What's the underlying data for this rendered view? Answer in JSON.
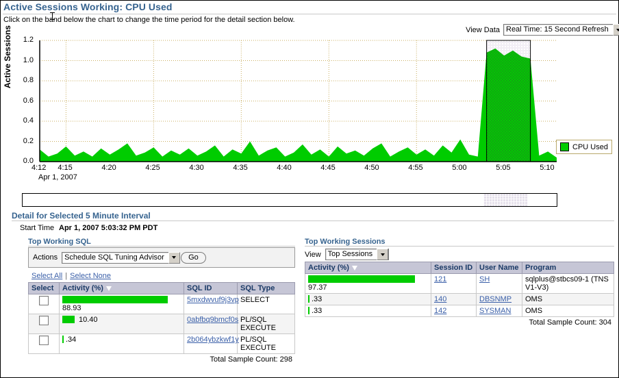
{
  "header": {
    "title": "Active Sessions Working: CPU Used",
    "instruction": "Click on the band below the chart to change the time period for the detail section below."
  },
  "view_data": {
    "label": "View Data",
    "value": "Real Time: 15 Second Refresh"
  },
  "chart_data": {
    "type": "area",
    "title": "Active Sessions Working: CPU Used",
    "xlabel": "",
    "ylabel": "Active Sessions",
    "date_label": "Apr 1, 2007",
    "ylim": [
      0.0,
      1.2
    ],
    "yticks": [
      "0.0",
      "0.2",
      "0.4",
      "0.6",
      "0.8",
      "1.0",
      "1.2"
    ],
    "xticks": [
      "4:12",
      "4:15",
      "4:20",
      "4:25",
      "4:30",
      "4:35",
      "4:40",
      "4:45",
      "4:50",
      "4:55",
      "5:00",
      "5:05",
      "5:10"
    ],
    "grid": true,
    "legend": [
      {
        "name": "CPU Used",
        "color": "#00cc00"
      }
    ],
    "legend_position": "right",
    "selection": {
      "from": "5:03:32",
      "to": "5:08:32",
      "highlight": true
    },
    "series": [
      {
        "name": "CPU Used",
        "color": "#00cc00",
        "x": [
          "4:12",
          "4:13",
          "4:14",
          "4:15",
          "4:16",
          "4:17",
          "4:18",
          "4:19",
          "4:20",
          "4:21",
          "4:22",
          "4:23",
          "4:24",
          "4:25",
          "4:26",
          "4:27",
          "4:28",
          "4:29",
          "4:30",
          "4:31",
          "4:32",
          "4:33",
          "4:34",
          "4:35",
          "4:36",
          "4:37",
          "4:38",
          "4:39",
          "4:40",
          "4:41",
          "4:42",
          "4:43",
          "4:44",
          "4:45",
          "4:46",
          "4:47",
          "4:48",
          "4:49",
          "4:50",
          "4:51",
          "4:52",
          "4:53",
          "4:54",
          "4:55",
          "4:56",
          "4:57",
          "4:58",
          "4:59",
          "5:00",
          "5:01",
          "5:02",
          "5:03",
          "5:04",
          "5:05",
          "5:06",
          "5:07",
          "5:08",
          "5:09",
          "5:10",
          "5:11"
        ],
        "values": [
          0.12,
          0.05,
          0.08,
          0.15,
          0.06,
          0.1,
          0.05,
          0.13,
          0.07,
          0.12,
          0.18,
          0.06,
          0.09,
          0.14,
          0.05,
          0.11,
          0.07,
          0.13,
          0.06,
          0.1,
          0.16,
          0.05,
          0.12,
          0.08,
          0.2,
          0.06,
          0.11,
          0.14,
          0.05,
          0.09,
          0.17,
          0.07,
          0.12,
          0.05,
          0.15,
          0.08,
          0.11,
          0.06,
          0.13,
          0.18,
          0.05,
          0.1,
          0.14,
          0.07,
          0.12,
          0.06,
          0.16,
          0.09,
          0.22,
          0.07,
          0.05,
          1.08,
          1.12,
          1.05,
          1.1,
          1.04,
          1.02,
          0.06,
          0.1,
          0.04
        ]
      }
    ]
  },
  "detail": {
    "title": "Detail for Selected 5 Minute Interval",
    "start_time_label": "Start Time",
    "start_time_value": "Apr 1, 2007 5:03:32 PM PDT"
  },
  "top_sql": {
    "title": "Top Working SQL",
    "actions_label": "Actions",
    "actions_value": "Schedule SQL Tuning Advisor",
    "go_label": "Go",
    "select_all": "Select All",
    "select_none": "Select None",
    "columns": [
      "Select",
      "Activity (%)",
      "SQL ID",
      "SQL Type"
    ],
    "rows": [
      {
        "activity": "88.93",
        "pct": 88.93,
        "sql_id": "5mxdwvuf9j3vp",
        "sql_type": "SELECT"
      },
      {
        "activity": "10.40",
        "pct": 10.4,
        "sql_id": "0abfbq9bmcf0s",
        "sql_type": "PL/SQL EXECUTE"
      },
      {
        "activity": ".34",
        "pct": 0.34,
        "sql_id": "2b064ybzkwf1y",
        "sql_type": "PL/SQL EXECUTE"
      }
    ],
    "total": "Total Sample Count: 298"
  },
  "top_sessions": {
    "title": "Top Working Sessions",
    "view_label": "View",
    "view_value": "Top Sessions",
    "columns": [
      "Activity (%)",
      "Session ID",
      "User Name",
      "Program"
    ],
    "rows": [
      {
        "activity": "97.37",
        "pct": 97.37,
        "session_id": "121",
        "user_name": "SH",
        "program": "sqlplus@stbcs09-1 (TNS V1-V3)"
      },
      {
        "activity": ".33",
        "pct": 0.33,
        "session_id": "140",
        "user_name": "DBSNMP",
        "program": "OMS"
      },
      {
        "activity": ".33",
        "pct": 0.33,
        "session_id": "142",
        "user_name": "SYSMAN",
        "program": "OMS"
      }
    ],
    "total": "Total Sample Count: 304"
  },
  "colors": {
    "accent": "#36638f",
    "series": "#00cc00",
    "grid": "#c0a860",
    "header": "#c6c6d6"
  }
}
